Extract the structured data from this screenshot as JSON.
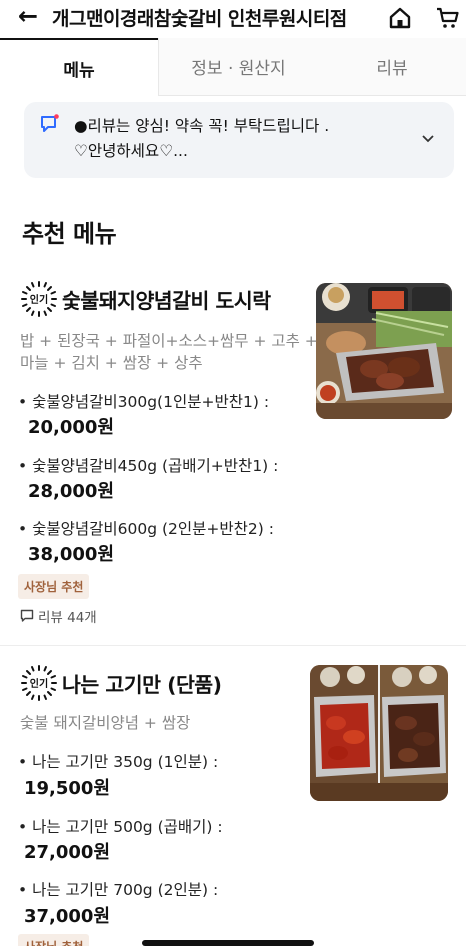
{
  "header": {
    "back_glyph": "←",
    "title": "개그맨이경래참숯갈비 인천루원시티점"
  },
  "tabs": [
    {
      "label": "메뉴"
    },
    {
      "label": "정보 · 원산지"
    },
    {
      "label": "리뷰"
    }
  ],
  "notice": {
    "text_line1": "●리뷰는 양심! 약속 꼭! 부탁드립니다 .",
    "text_line2": "♡안녕하세요♡..."
  },
  "section": {
    "title": "추천 메뉴"
  },
  "items": [
    {
      "popular_badge": "인기",
      "name": "숯불돼지양념갈비 도시락",
      "desc_line1": "밥 + 된장국 + 파절이+소스+쌈무 + 고추 +",
      "desc_line2": "마늘 + 김치 + 쌈장 + 상추",
      "options": [
        {
          "label": "• 숯불양념갈비300g(1인분+반찬1) :",
          "price": "20,000원"
        },
        {
          "label": "• 숯불양념갈비450g (곱배기+반찬1) :",
          "price": "28,000원"
        },
        {
          "label": "• 숯불양념갈비600g (2인분+반찬2) :",
          "price": "38,000원"
        }
      ],
      "owner_badge": "사장님 추천",
      "review_count": "리뷰 44개"
    },
    {
      "popular_badge": "인기",
      "name": "나는 고기만 (단품)",
      "desc_line1": "숯불 돼지갈비양념 + 쌈장",
      "options": [
        {
          "label": "• 나는 고기만  350g (1인분) :",
          "price": "19,500원"
        },
        {
          "label": "• 나는 고기만 500g (곱배기) :",
          "price": "27,000원"
        },
        {
          "label": "• 나는 고기만 700g (2인분) :",
          "price": "37,000원"
        }
      ],
      "owner_badge": "사장님 추천"
    }
  ],
  "colors": {
    "accent_blue": "#2f6bff",
    "badge_bg": "#f6ede6",
    "badge_text": "#a0623c"
  }
}
